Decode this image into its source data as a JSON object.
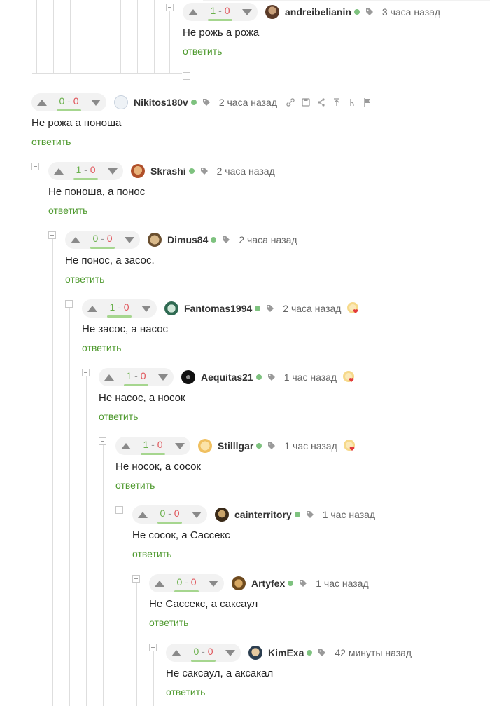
{
  "reply_label": "ответить",
  "colors": {
    "plus": "#6ab04c",
    "minus": "#e0555b",
    "reply": "#4f9a2f",
    "online": "#7ec27f",
    "rating_bg": "#f2f2f2",
    "thread_line": "#dedede"
  },
  "comments": [
    {
      "author": "andreibelianin",
      "plus": "1",
      "minus": "0",
      "time": "3 часа назад",
      "text": "Не рожь а рожа",
      "avatar_icon": "andreibelianin-avatar",
      "award": false
    },
    {
      "author": "Nikitos180v",
      "plus": "0",
      "minus": "0",
      "time": "2 часа назад",
      "text": "Не рожа а поноша",
      "avatar_icon": "nikitos180v-avatar",
      "award": false,
      "actions": [
        "link-icon",
        "save-icon",
        "share-icon",
        "scroll-to-top-icon",
        "branch-icon",
        "report-flag-icon"
      ]
    },
    {
      "author": "Skrashi",
      "plus": "1",
      "minus": "0",
      "time": "2 часа назад",
      "text": "Не поноша, а понос",
      "avatar_icon": "skrashi-avatar",
      "award": false
    },
    {
      "author": "Dimus84",
      "plus": "0",
      "minus": "0",
      "time": "2 часа назад",
      "text": "Не понос, а засос.",
      "avatar_icon": "dimus84-avatar",
      "award": false
    },
    {
      "author": "Fantomas1994",
      "plus": "1",
      "minus": "0",
      "time": "2 часа назад",
      "text": "Не засос, а насос",
      "avatar_icon": "fantomas1994-avatar",
      "award": true
    },
    {
      "author": "Aequitas21",
      "plus": "1",
      "minus": "0",
      "time": "1 час назад",
      "text": "Не насос, а носок",
      "avatar_icon": "aequitas21-avatar",
      "award": true
    },
    {
      "author": "Stilllgar",
      "plus": "1",
      "minus": "0",
      "time": "1 час назад",
      "text": "Не носок, а сосок",
      "avatar_icon": "stilllgar-avatar",
      "award": true
    },
    {
      "author": "cainterritory",
      "plus": "0",
      "minus": "0",
      "time": "1 час назад",
      "text": "Не сосок, а Сассекс",
      "avatar_icon": "cainterritory-avatar",
      "award": false
    },
    {
      "author": "Artyfex",
      "plus": "0",
      "minus": "0",
      "time": "1 час назад",
      "text": "Не Сассекс, а саксаул",
      "avatar_icon": "artyfex-avatar",
      "award": false
    },
    {
      "author": "KimExa",
      "plus": "0",
      "minus": "0",
      "time": "42 минуты назад",
      "text": "Не саксаул, а аксакал",
      "avatar_icon": "kimexa-avatar",
      "award": false
    }
  ]
}
